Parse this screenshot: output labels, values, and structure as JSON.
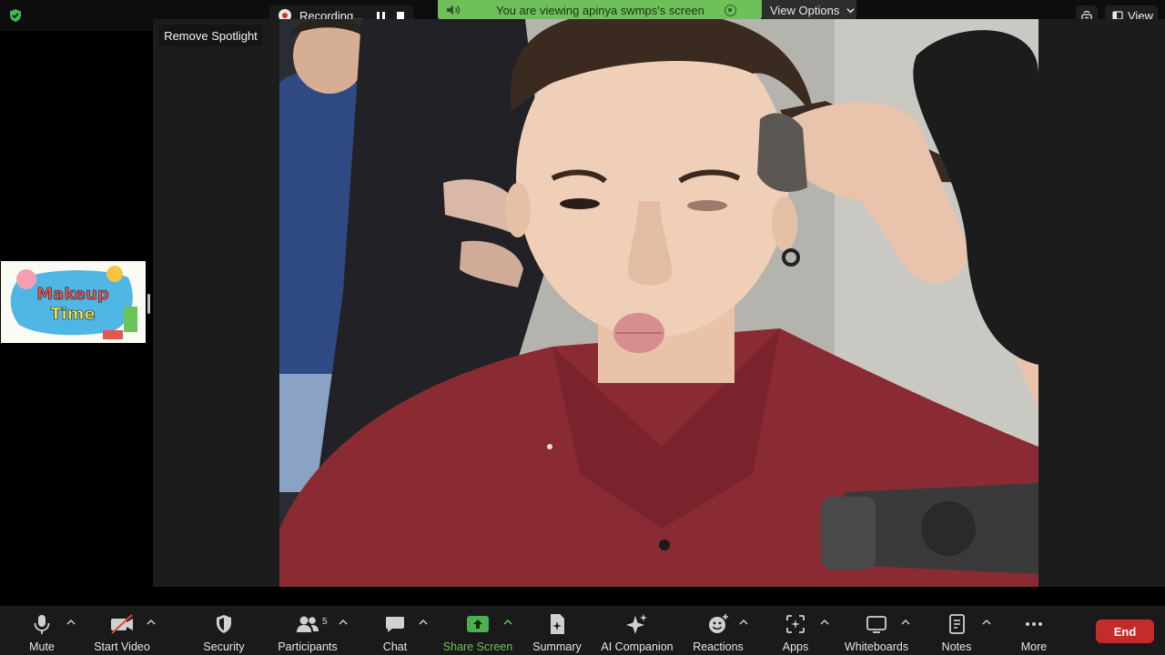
{
  "recording": {
    "label": "Recording..."
  },
  "banner": {
    "text": "You are viewing apinya swmps's screen",
    "view_options": "View Options"
  },
  "top_right": {
    "view_label": "View"
  },
  "stage": {
    "remove_spotlight": "Remove Spotlight"
  },
  "thumbnail": {
    "line1": "Makeup",
    "line2": "Time"
  },
  "toolbar": {
    "mute": "Mute",
    "start_video": "Start Video",
    "security": "Security",
    "participants": "Participants",
    "participants_count": "5",
    "chat": "Chat",
    "share_screen": "Share Screen",
    "summary": "Summary",
    "ai_companion": "AI Companion",
    "reactions": "Reactions",
    "apps": "Apps",
    "whiteboards": "Whiteboards",
    "notes": "Notes",
    "more": "More",
    "end": "End"
  },
  "colors": {
    "accent_green": "#6ec05a",
    "end_red": "#c42b2b",
    "toolbar_bg": "#1a1a1a"
  },
  "icons": [
    "shield-icon",
    "record-icon",
    "pause-icon",
    "stop-icon",
    "speaker-icon",
    "close-icon",
    "chevron-down-icon",
    "immersive-icon",
    "view-icon",
    "microphone-icon",
    "video-off-icon",
    "security-shield-icon",
    "participants-icon",
    "chat-icon",
    "share-screen-icon",
    "summary-icon",
    "ai-companion-icon",
    "reactions-icon",
    "apps-icon",
    "whiteboards-icon",
    "notes-icon",
    "more-icon"
  ]
}
